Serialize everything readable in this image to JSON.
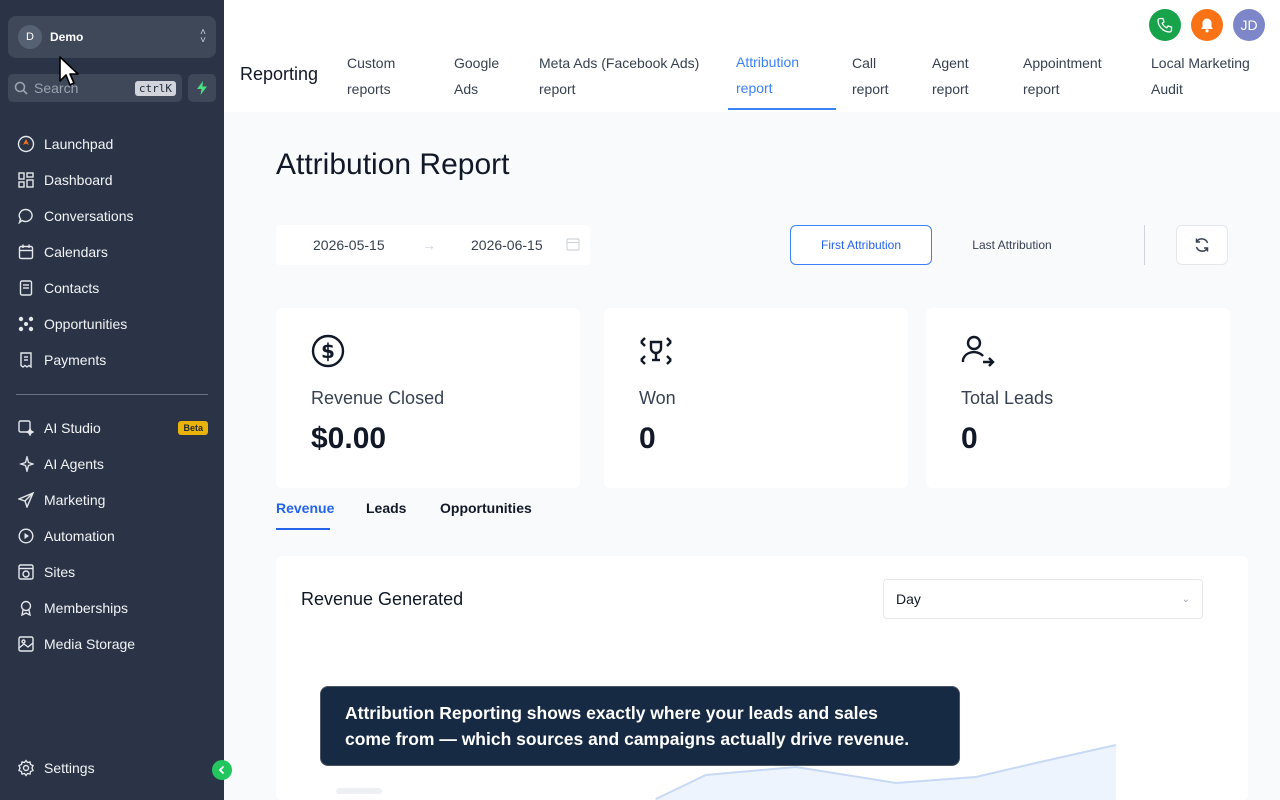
{
  "sidebar": {
    "account_initials": "D",
    "account_name": "Demo",
    "search_placeholder": "Search",
    "search_shortcut": "ctrlK",
    "nav_primary": [
      {
        "label": "Launchpad",
        "icon": "rocket-icon"
      },
      {
        "label": "Dashboard",
        "icon": "grid-icon"
      },
      {
        "label": "Conversations",
        "icon": "chat-icon"
      },
      {
        "label": "Calendars",
        "icon": "calendar-icon"
      },
      {
        "label": "Contacts",
        "icon": "contact-book-icon"
      },
      {
        "label": "Opportunities",
        "icon": "network-icon"
      },
      {
        "label": "Payments",
        "icon": "receipt-icon"
      }
    ],
    "nav_secondary": [
      {
        "label": "AI Studio",
        "icon": "ai-studio-icon",
        "badge": "Beta"
      },
      {
        "label": "AI Agents",
        "icon": "sparkle-icon"
      },
      {
        "label": "Marketing",
        "icon": "send-icon"
      },
      {
        "label": "Automation",
        "icon": "play-circle-icon"
      },
      {
        "label": "Sites",
        "icon": "globe-window-icon"
      },
      {
        "label": "Memberships",
        "icon": "award-icon"
      },
      {
        "label": "Media Storage",
        "icon": "image-icon"
      }
    ],
    "settings_label": "Settings"
  },
  "header": {
    "section": "Reporting",
    "tabs": [
      {
        "line1": "Custom",
        "line2": "reports"
      },
      {
        "line1": "Google",
        "line2": "Ads"
      },
      {
        "line1": "Meta Ads (Facebook Ads)",
        "line2": "report"
      },
      {
        "line1": "Attribution",
        "line2": "report",
        "active": true
      },
      {
        "line1": "Call",
        "line2": "report"
      },
      {
        "line1": "Agent",
        "line2": "report"
      },
      {
        "line1": "Appointment",
        "line2": "report"
      },
      {
        "line1": "Local Marketing",
        "line2": "Audit"
      }
    ],
    "avatar_initials": "JD",
    "colors": {
      "phone": "#16a34a",
      "bell": "#f97316",
      "avatar": "#7c86c9",
      "accent": "#3b82f6"
    }
  },
  "page": {
    "title": "Attribution Report",
    "date_start": "2026-05-15",
    "date_end": "2026-06-15",
    "first_attribution": "First Attribution",
    "last_attribution": "Last Attribution"
  },
  "stats": [
    {
      "label": "Revenue Closed",
      "value": "$0.00",
      "icon": "dollar-circle-icon"
    },
    {
      "label": "Won",
      "value": "0",
      "icon": "trophy-arrows-icon"
    },
    {
      "label": "Total Leads",
      "value": "0",
      "icon": "user-arrow-icon"
    }
  ],
  "subtabs": [
    "Revenue",
    "Leads",
    "Opportunities"
  ],
  "panel": {
    "title": "Revenue Generated",
    "granularity": "Day"
  },
  "tooltip": {
    "line1": "Attribution Reporting shows exactly where your leads and sales",
    "line2": "come from — which sources and campaigns actually drive revenue."
  }
}
